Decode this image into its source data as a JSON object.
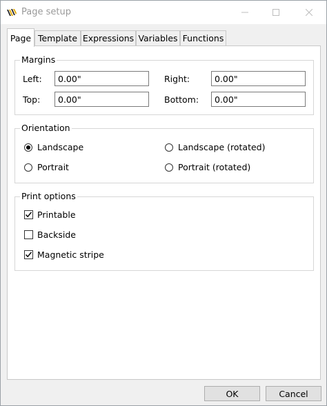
{
  "window": {
    "title": "Page setup"
  },
  "tabs": [
    {
      "label": "Page"
    },
    {
      "label": "Template"
    },
    {
      "label": "Expressions"
    },
    {
      "label": "Variables"
    },
    {
      "label": "Functions"
    }
  ],
  "margins": {
    "legend": "Margins",
    "left_label": "Left:",
    "left_value": "0.00\"",
    "right_label": "Right:",
    "right_value": "0.00\"",
    "top_label": "Top:",
    "top_value": "0.00\"",
    "bottom_label": "Bottom:",
    "bottom_value": "0.00\""
  },
  "orientation": {
    "legend": "Orientation",
    "landscape": "Landscape",
    "portrait": "Portrait",
    "landscape_rotated": "Landscape (rotated)",
    "portrait_rotated": "Portrait (rotated)",
    "selected": "Landscape"
  },
  "print_options": {
    "legend": "Print options",
    "printable": "Printable",
    "printable_checked": true,
    "backside": "Backside",
    "backside_checked": false,
    "magnetic_stripe": "Magnetic stripe",
    "magnetic_stripe_checked": true
  },
  "buttons": {
    "ok": "OK",
    "cancel": "Cancel"
  },
  "icons": {
    "app": "app-logo-icon",
    "minimize": "minimize-icon",
    "maximize": "maximize-icon",
    "close": "close-icon",
    "check": "checkmark-icon"
  }
}
